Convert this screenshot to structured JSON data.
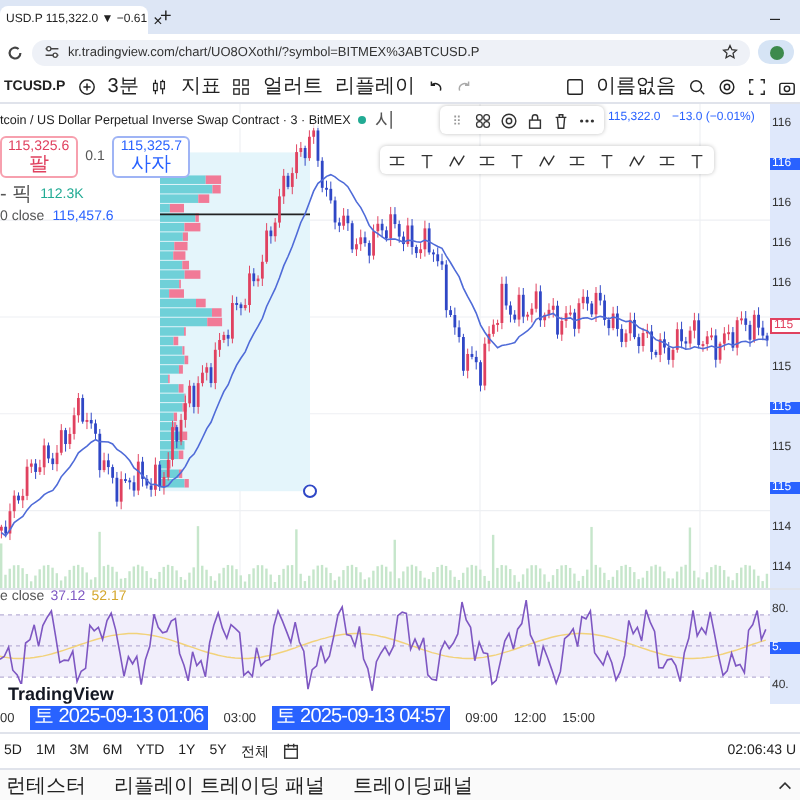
{
  "browser": {
    "tab_title": "USD.P 115,322.0 ▼ −0.61",
    "tab_close": "×",
    "new_tab": "+",
    "minimize": "–",
    "url": "kr.tradingview.com/chart/UO8OXothI/?symbol=BITMEX%3ABTCUSD.P"
  },
  "toolbar": {
    "symbol": "TCUSD.P",
    "interval": "3분",
    "indicators": "지표",
    "alerts": "얼러트",
    "replay": "리플레이",
    "layout_name": "이름없음"
  },
  "legend": {
    "title": "tcoin / US Dollar Perpetual Inverse Swap Contract · 3 · BitMEX",
    "market_status": "시",
    "sell_price": "115,325.6",
    "sell_label": "팔",
    "spread": "0.1",
    "buy_price": "115,325.7",
    "buy_label": "사자",
    "volume_label": "- 픽",
    "volume_value": "112.3K",
    "ma_label": "0 close",
    "ma_value": "115,457.6",
    "last_price": "115,322.0",
    "change": "−13.0 (−0.01%)"
  },
  "price_axis": [
    {
      "text": "116",
      "kind": "label"
    },
    {
      "text": "116",
      "kind": "tag"
    },
    {
      "text": "116",
      "kind": "label"
    },
    {
      "text": "116",
      "kind": "label"
    },
    {
      "text": "116",
      "kind": "label"
    },
    {
      "text": "115",
      "kind": "last"
    },
    {
      "text": "115",
      "kind": "label"
    },
    {
      "text": "115",
      "kind": "tag"
    },
    {
      "text": "115",
      "kind": "label"
    },
    {
      "text": "115",
      "kind": "tag"
    },
    {
      "text": "114",
      "kind": "label"
    },
    {
      "text": "114",
      "kind": "label"
    }
  ],
  "rsi": {
    "label": "e close",
    "value": "37.12",
    "ma_value": "52.17",
    "axis": [
      {
        "text": "80.",
        "kind": "label"
      },
      {
        "text": "5.",
        "kind": "tag"
      },
      {
        "text": "40.",
        "kind": "label"
      }
    ]
  },
  "logo": "TradingView",
  "time_axis": [
    {
      "text": "00",
      "kind": "label"
    },
    {
      "text": "토 2025-09-13  01:06",
      "kind": "tag"
    },
    {
      "text": "03:00",
      "kind": "label"
    },
    {
      "text": "토 2025-09-13  04:57",
      "kind": "tag"
    },
    {
      "text": "09:00",
      "kind": "label"
    },
    {
      "text": "12:00",
      "kind": "label"
    },
    {
      "text": "15:00",
      "kind": "label"
    }
  ],
  "ranges": [
    {
      "label": "5D"
    },
    {
      "label": "1M"
    },
    {
      "label": "3M"
    },
    {
      "label": "6M"
    },
    {
      "label": "YTD"
    },
    {
      "label": "1Y"
    },
    {
      "label": "5Y"
    },
    {
      "label": "전체"
    }
  ],
  "clock": "02:06:43 U",
  "panels": [
    {
      "label": "런테스터"
    },
    {
      "label": "리플레이 트레이딩 패널"
    },
    {
      "label": "트레이딩패널"
    }
  ]
}
